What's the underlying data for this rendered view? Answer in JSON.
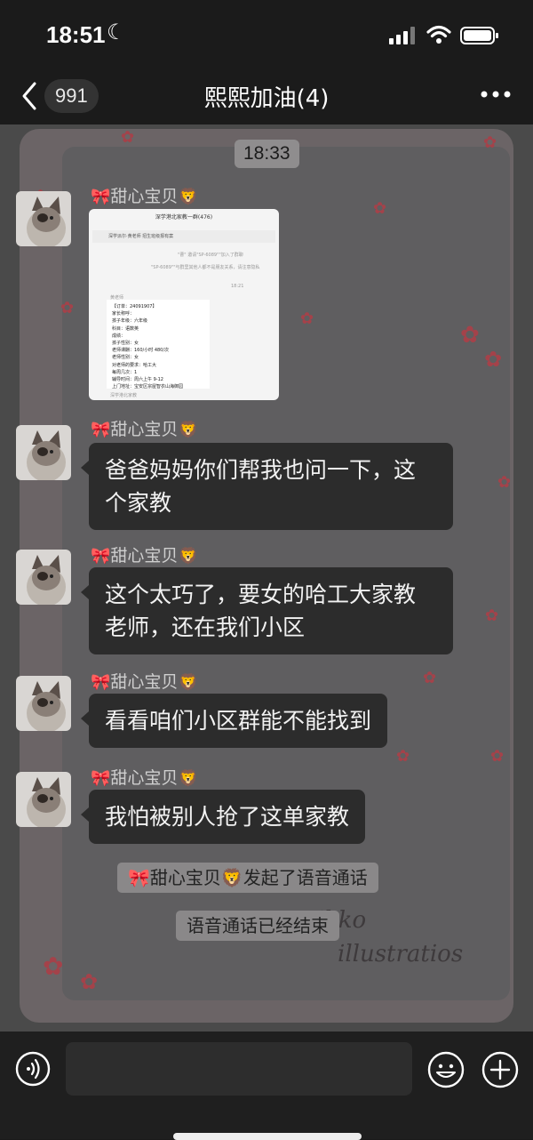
{
  "status_bar": {
    "time": "18:51",
    "moon_icon": "moon-icon",
    "signal_icon": "signal-icon",
    "wifi_icon": "wifi-icon",
    "battery_icon": "battery-icon"
  },
  "nav": {
    "back_icon": "chevron-left-icon",
    "unread_count": "991",
    "title": "熙熙加油(4)",
    "more_icon": "more-dots-icon"
  },
  "chat": {
    "time_divider": "18:33",
    "sender_name": "甜心宝贝",
    "sender_prefix_emoji": "🎀",
    "sender_suffix_emoji": "🦁",
    "image_message": {
      "header": "深学港北家教一群(476)",
      "pinned": "深学派尔·黄老师 招生班级报有案",
      "line1": "\"曹\" 邀请\"SP-6089\"\"加入了群聊",
      "line2": "\"SP-6089\"\"与群里其他人都不是朋友关系，请注意隐私",
      "time": "18:21",
      "card_sender": "黄老师",
      "card_lines": [
        "【订单：24091907】",
        "家长称呼：",
        "孩子年级：六年级",
        "科目：语数英",
        "成绩：",
        "孩子性别：女",
        "老师课酬：160/小时 480/次",
        "老师性别：女",
        "对老师的要求：哈工大",
        "每周几次：1",
        "辅导时间：周六上午 9-12",
        "上门地址：宝安区宗屋智衣山海御园"
      ],
      "footer": "深学港北家教"
    },
    "messages": [
      {
        "text": "爸爸妈妈你们帮我也问一下，这个家教",
        "line1": "爸爸妈妈你们帮我也问一下，这",
        "line2": "个家教"
      },
      {
        "text": "这个太巧了，要女的哈工大家教老师，还在我们小区",
        "line1": "这个太巧了，要女的哈工大家教",
        "line2": "老师，还在我们小区"
      },
      {
        "text": "看看咱们小区群能不能找到"
      },
      {
        "text": "我怕被别人抢了这单家教"
      }
    ],
    "system_call_started": "发起了语音通话",
    "system_call_ended": "语音通话已经结束",
    "wallpaper_text_1": "Mikko",
    "wallpaper_text_2": "illustratios"
  },
  "input_bar": {
    "voice_icon": "voice-input-icon",
    "emoji_icon": "emoji-icon",
    "plus_icon": "plus-icon"
  },
  "colors": {
    "bubble": "#2c2c2c",
    "background": "#1b1b1b",
    "wallpaper": "#5f5e60"
  }
}
